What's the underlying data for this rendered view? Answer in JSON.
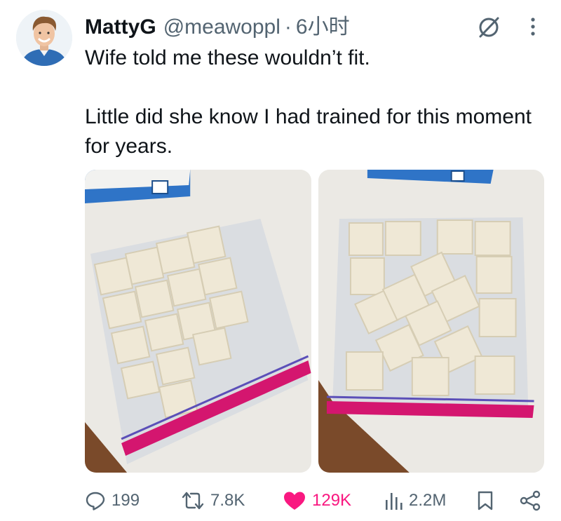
{
  "author": {
    "display_name": "MattyG",
    "handle": "@meawoppl",
    "separator": "·",
    "timestamp": "6小时"
  },
  "tweet": {
    "paragraphs": [
      "Wife told me these wouldn’t fit.",
      "Little did she know I had trained for this moment for years."
    ]
  },
  "media": {
    "photo_count": 2
  },
  "actions": {
    "replies": "199",
    "reposts": "7.8K",
    "likes": "129K",
    "views": "2.2M"
  },
  "colors": {
    "like_active": "#f91880",
    "secondary_text": "#536471",
    "primary_text": "#0f1419"
  },
  "icons": {
    "reply": "reply-icon",
    "repost": "repost-icon",
    "like": "heart-icon",
    "views": "analytics-icon",
    "bookmark": "bookmark-icon",
    "share": "share-icon",
    "grok": "grok-icon",
    "more": "more-icon"
  }
}
